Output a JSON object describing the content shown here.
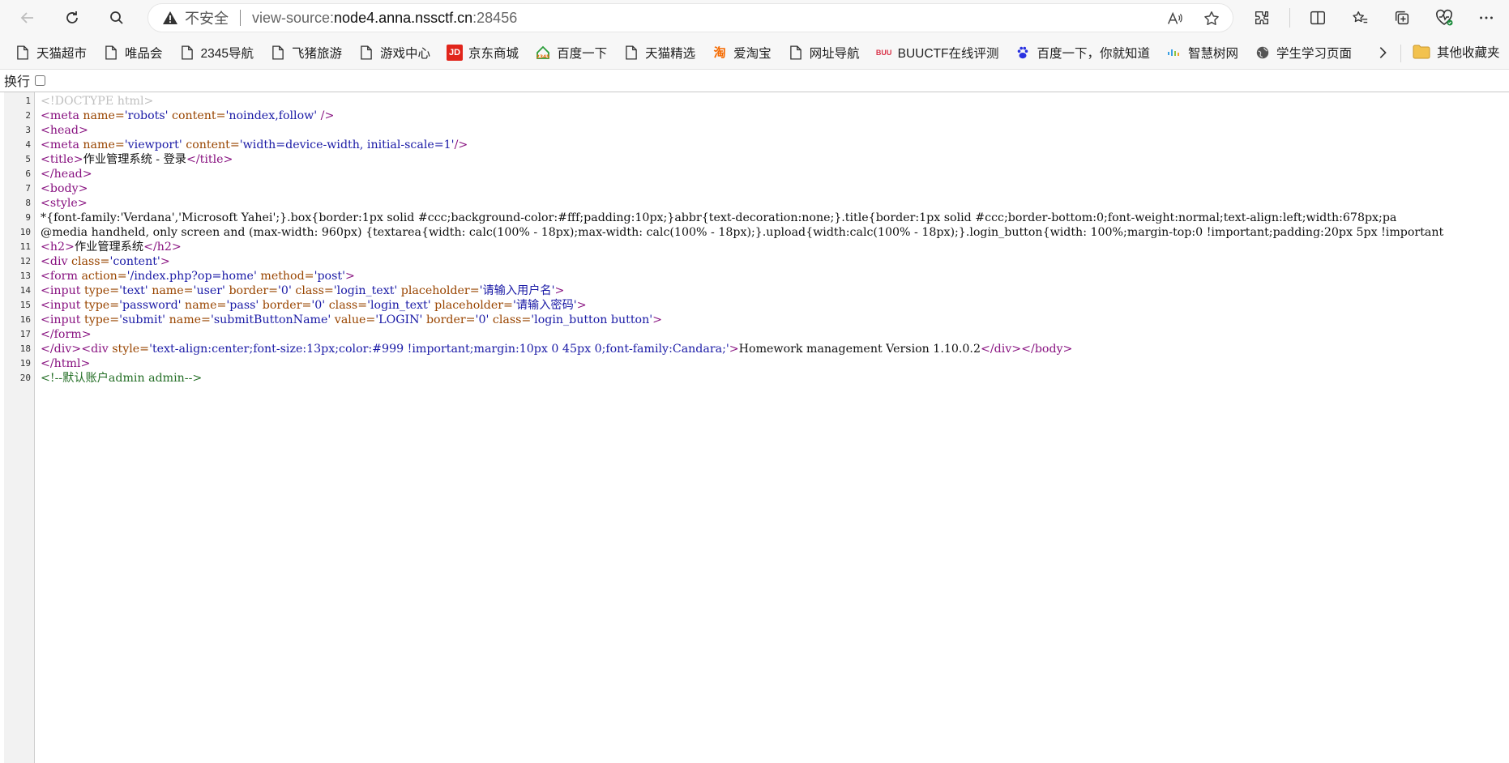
{
  "browser": {
    "insecure_label": "不安全",
    "url_prefix": "view-source:",
    "url_host": "node4.anna.nssctf.cn",
    "url_port": ":28456"
  },
  "bookmarks": [
    {
      "label": "天猫超市",
      "icon": "page-icon"
    },
    {
      "label": "唯品会",
      "icon": "page-icon"
    },
    {
      "label": "2345导航",
      "icon": "page-icon"
    },
    {
      "label": "飞猪旅游",
      "icon": "page-icon"
    },
    {
      "label": "游戏中心",
      "icon": "page-icon"
    },
    {
      "label": "京东商城",
      "icon": "jd-icon"
    },
    {
      "label": "百度一下",
      "icon": "2345-icon"
    },
    {
      "label": "天猫精选",
      "icon": "page-icon"
    },
    {
      "label": "爱淘宝",
      "icon": "taobao-icon"
    },
    {
      "label": "网址导航",
      "icon": "page-icon"
    },
    {
      "label": "BUUCTF在线评测",
      "icon": "buuctf-icon"
    },
    {
      "label": "百度一下，你就知道",
      "icon": "baidu-paw-icon"
    },
    {
      "label": "智慧树网",
      "icon": "zhihuishu-icon"
    },
    {
      "label": "学生学习页面",
      "icon": "globe-icon"
    }
  ],
  "other_bookmarks": "其他收藏夹",
  "wrap_label": "换行",
  "source_lines": [
    {
      "n": "1",
      "parts": [
        [
          "doctype",
          "<!DOCTYPE html>"
        ]
      ]
    },
    {
      "n": "2",
      "parts": [
        [
          "tag",
          "<meta "
        ],
        [
          "attr",
          "name="
        ],
        [
          "val",
          "'robots'"
        ],
        [
          "attr",
          " content="
        ],
        [
          "val",
          "'noindex,follow'"
        ],
        [
          "tag",
          " />"
        ]
      ]
    },
    {
      "n": "3",
      "parts": [
        [
          "tag",
          "<head>"
        ]
      ]
    },
    {
      "n": "4",
      "parts": [
        [
          "tag",
          "<meta "
        ],
        [
          "attr",
          "name="
        ],
        [
          "val",
          "'viewport'"
        ],
        [
          "attr",
          " content="
        ],
        [
          "val",
          "'width=device-width, initial-scale=1'"
        ],
        [
          "tag",
          "/>"
        ]
      ]
    },
    {
      "n": "5",
      "parts": [
        [
          "tag",
          "<title>"
        ],
        [
          "text",
          "作业管理系统 - 登录"
        ],
        [
          "tag",
          "</title>"
        ]
      ]
    },
    {
      "n": "6",
      "parts": [
        [
          "tag",
          "</head>"
        ]
      ]
    },
    {
      "n": "7",
      "parts": [
        [
          "tag",
          "<body>"
        ]
      ]
    },
    {
      "n": "8",
      "parts": [
        [
          "tag",
          "<style>"
        ]
      ]
    },
    {
      "n": "9",
      "parts": [
        [
          "text",
          "*{font-family:'Verdana','Microsoft Yahei';}.box{border:1px solid #ccc;background-color:#fff;padding:10px;}abbr{text-decoration:none;}.title{border:1px solid #ccc;border-bottom:0;font-weight:normal;text-align:left;width:678px;pa"
        ]
      ]
    },
    {
      "n": "10",
      "parts": [
        [
          "text",
          "@media handheld, only screen and (max-width: 960px) {textarea{width: calc(100% - 18px);max-width: calc(100% - 18px);}.upload{width:calc(100% - 18px);}.login_button{width: 100%;margin-top:0 !important;padding:20px 5px !important"
        ]
      ]
    },
    {
      "n": "11",
      "parts": [
        [
          "tag",
          "<h2>"
        ],
        [
          "text",
          "作业管理系统"
        ],
        [
          "tag",
          "</h2>"
        ]
      ]
    },
    {
      "n": "12",
      "parts": [
        [
          "tag",
          "<div "
        ],
        [
          "attr",
          "class="
        ],
        [
          "val",
          "'content'"
        ],
        [
          "tag",
          ">"
        ]
      ]
    },
    {
      "n": "13",
      "parts": [
        [
          "tag",
          "<form "
        ],
        [
          "attr",
          "action="
        ],
        [
          "val",
          "'/index.php?op=home'"
        ],
        [
          "attr",
          " method="
        ],
        [
          "val",
          "'post'"
        ],
        [
          "tag",
          ">"
        ]
      ]
    },
    {
      "n": "14",
      "parts": [
        [
          "tag",
          "<input "
        ],
        [
          "attr",
          "type="
        ],
        [
          "val",
          "'text'"
        ],
        [
          "attr",
          " name="
        ],
        [
          "val",
          "'user'"
        ],
        [
          "attr",
          " border="
        ],
        [
          "val",
          "'0'"
        ],
        [
          "attr",
          " class="
        ],
        [
          "val",
          "'login_text'"
        ],
        [
          "attr",
          " placeholder="
        ],
        [
          "val",
          "'请输入用户名'"
        ],
        [
          "tag",
          ">"
        ]
      ]
    },
    {
      "n": "15",
      "parts": [
        [
          "tag",
          "<input "
        ],
        [
          "attr",
          "type="
        ],
        [
          "val",
          "'password'"
        ],
        [
          "attr",
          " name="
        ],
        [
          "val",
          "'pass'"
        ],
        [
          "attr",
          " border="
        ],
        [
          "val",
          "'0'"
        ],
        [
          "attr",
          " class="
        ],
        [
          "val",
          "'login_text'"
        ],
        [
          "attr",
          " placeholder="
        ],
        [
          "val",
          "'请输入密码'"
        ],
        [
          "tag",
          ">"
        ]
      ]
    },
    {
      "n": "16",
      "parts": [
        [
          "tag",
          "<input "
        ],
        [
          "attr",
          "type="
        ],
        [
          "val",
          "'submit'"
        ],
        [
          "attr",
          " name="
        ],
        [
          "val",
          "'submitButtonName'"
        ],
        [
          "attr",
          " value="
        ],
        [
          "val",
          "'LOGIN'"
        ],
        [
          "attr",
          " border="
        ],
        [
          "val",
          "'0'"
        ],
        [
          "attr",
          " class="
        ],
        [
          "val",
          "'login_button button'"
        ],
        [
          "tag",
          ">"
        ]
      ]
    },
    {
      "n": "17",
      "parts": [
        [
          "tag",
          "</form>"
        ]
      ]
    },
    {
      "n": "18",
      "parts": [
        [
          "tag",
          "</div><div "
        ],
        [
          "attr",
          "style="
        ],
        [
          "val",
          "'text-align:center;font-size:13px;color:#999 !important;margin:10px 0 45px 0;font-family:Candara;'"
        ],
        [
          "tag",
          ">"
        ],
        [
          "text",
          "Homework management Version 1.10.0.2"
        ],
        [
          "tag",
          "</div></body>"
        ]
      ]
    },
    {
      "n": "19",
      "parts": [
        [
          "tag",
          "</html>"
        ]
      ]
    },
    {
      "n": "20",
      "parts": [
        [
          "comment",
          "<!--默认账户admin admin-->"
        ]
      ]
    }
  ]
}
